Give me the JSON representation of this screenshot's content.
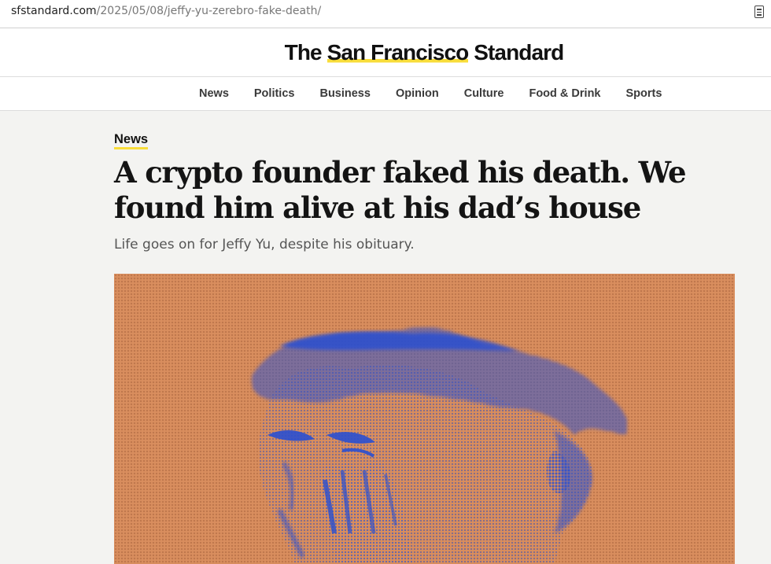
{
  "browser": {
    "url_domain": "sfstandard.com",
    "url_path": "/2025/05/08/jeffy-yu-zerebro-fake-death/",
    "reader_icon": "reader-mode-icon"
  },
  "masthead": {
    "brand_prefix": "The ",
    "brand_highlight": "San Francisco",
    "brand_suffix": " Standard",
    "accent_color": "#f8dd3a"
  },
  "nav": {
    "items": [
      {
        "label": "News"
      },
      {
        "label": "Politics"
      },
      {
        "label": "Business"
      },
      {
        "label": "Opinion"
      },
      {
        "label": "Culture"
      },
      {
        "label": "Food & Drink"
      },
      {
        "label": "Sports"
      }
    ]
  },
  "article": {
    "kicker": "News",
    "headline": "A crypto founder faked his death. We found him alive at his dad’s house",
    "dek": "Life goes on for Jeffy Yu, despite his obituary."
  },
  "hero": {
    "background_color": "#d98e5e",
    "ink_color": "#2a4fd0"
  }
}
